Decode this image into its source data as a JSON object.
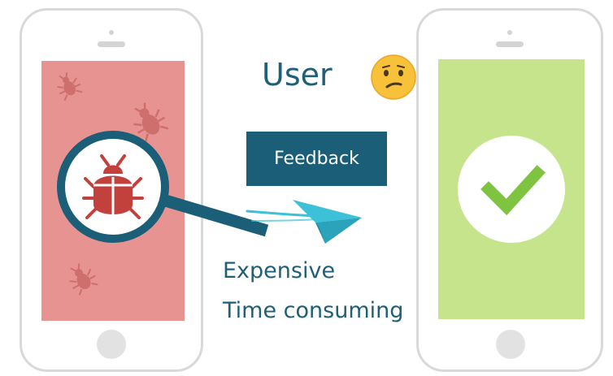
{
  "title": "User",
  "feedback_label": "Feedback",
  "costs": [
    "Expensive",
    "Time consuming"
  ],
  "emoji": "confused-face",
  "colors": {
    "text": "#1f5f78",
    "feedback_bg": "#1a5e77",
    "bug_screen": "#e79391",
    "bug_dark": "#c2413d",
    "bug_light": "#cf6f6d",
    "ok_screen": "#c5e48b",
    "check": "#7ec440",
    "plane": "#3cc1d8",
    "magnifier": "#1a5e77",
    "phone_frame": "#d9d9d9"
  }
}
